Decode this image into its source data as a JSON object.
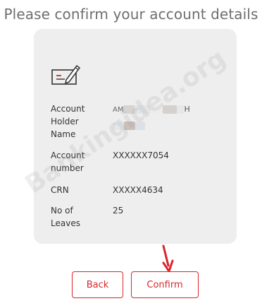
{
  "page": {
    "heading": "Please confirm your account details"
  },
  "details": [
    {
      "label": "Account Holder Name",
      "value": "AM H"
    },
    {
      "label": "Account number",
      "value": "XXXXXX7054"
    },
    {
      "label": "CRN",
      "value": "XXXXX4634"
    },
    {
      "label": "No of Leaves",
      "value": "25"
    }
  ],
  "labels_split": {
    "holder_line1": "Account",
    "holder_line2": "Holder",
    "holder_line3": "Name",
    "number_line1": "Account",
    "number_line2": "number",
    "crn": "CRN",
    "leaves_line1": "No of",
    "leaves_line2": "Leaves"
  },
  "values": {
    "holder_start": "AM",
    "holder_end": "H",
    "account_number": "XXXXXX7054",
    "crn": "XXXXX4634",
    "leaves": "25"
  },
  "watermark": "Bankingidea.org",
  "buttons": {
    "back": "Back",
    "confirm": "Confirm"
  },
  "icons": {
    "cheque": "cheque-book-icon",
    "arrow": "red-arrow-down-icon"
  },
  "colors": {
    "accent": "#d9262a",
    "card": "#eeeeee",
    "heading": "#6e6e6e"
  }
}
